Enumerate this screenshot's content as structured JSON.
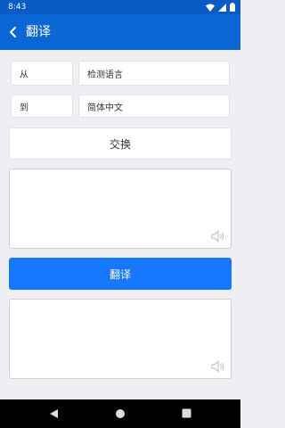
{
  "status_bar": {
    "time": "8:43"
  },
  "app_bar": {
    "title": "翻译"
  },
  "from": {
    "label": "从",
    "value": "检测语言"
  },
  "to": {
    "label": "到",
    "value": "简体中文"
  },
  "swap_label": "交换",
  "source_text": {
    "value": ""
  },
  "translate_label": "翻译",
  "result_text": {
    "value": ""
  },
  "colors": {
    "primary": "#0b66d6",
    "status_bar": "#0a5bc4",
    "button": "#1677ff",
    "background": "#eeeff3"
  }
}
